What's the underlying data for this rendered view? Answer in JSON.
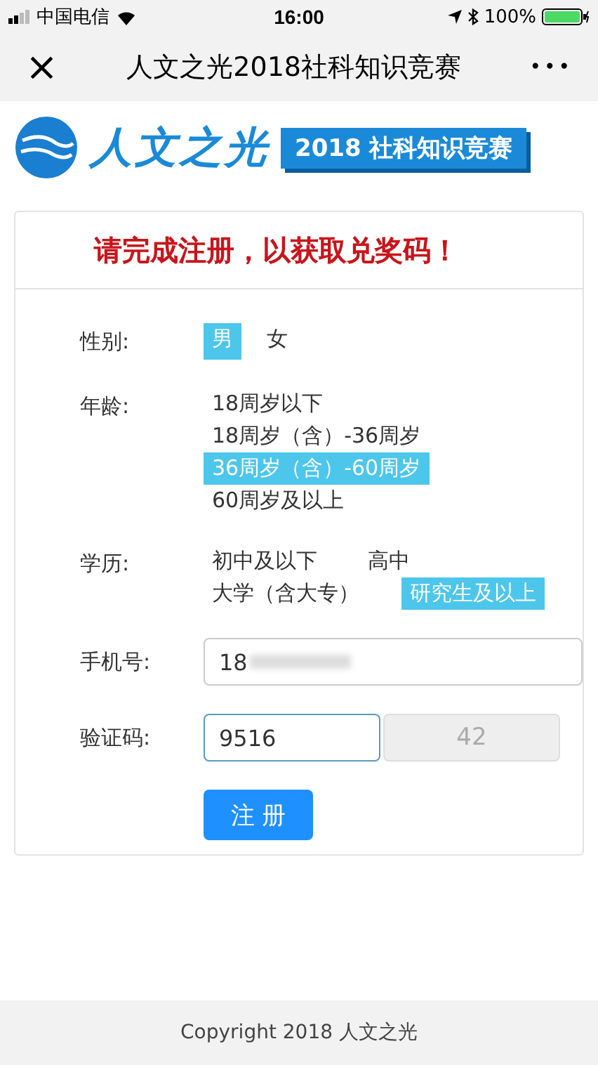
{
  "status_bar": {
    "carrier": "中国电信",
    "time": "16:00",
    "battery": "100%"
  },
  "nav": {
    "close": "×",
    "title": "人文之光2018社科知识竞赛",
    "more": "•••"
  },
  "banner": {
    "name": "人文之光",
    "badge": "2018 社科知识竞赛"
  },
  "form": {
    "heading": "请完成注册，以获取兑奖码！",
    "groups": [
      {
        "label": "性别:",
        "kind": "inline",
        "options": [
          {
            "text": "男",
            "selected": true
          },
          {
            "text": "女",
            "selected": false
          }
        ]
      },
      {
        "label": "年龄:",
        "kind": "stack",
        "options": [
          {
            "text": "18周岁以下",
            "selected": false
          },
          {
            "text": "18周岁（含）-36周岁",
            "selected": false
          },
          {
            "text": "36周岁（含）-60周岁",
            "selected": true
          },
          {
            "text": "60周岁及以上",
            "selected": false
          }
        ]
      },
      {
        "label": "学历:",
        "kind": "wrap",
        "options": [
          {
            "text": "初中及以下",
            "selected": false
          },
          {
            "text": "高中",
            "selected": false
          },
          {
            "text": "大学（含大专）",
            "selected": false
          },
          {
            "text": "研究生及以上",
            "selected": true
          }
        ]
      }
    ],
    "phone": {
      "label": "手机号:",
      "value": "18"
    },
    "code": {
      "label": "验证码:",
      "value": "9516",
      "countdown": "42"
    },
    "submit": "注 册"
  },
  "footer": "Copyright 2018 人文之光"
}
